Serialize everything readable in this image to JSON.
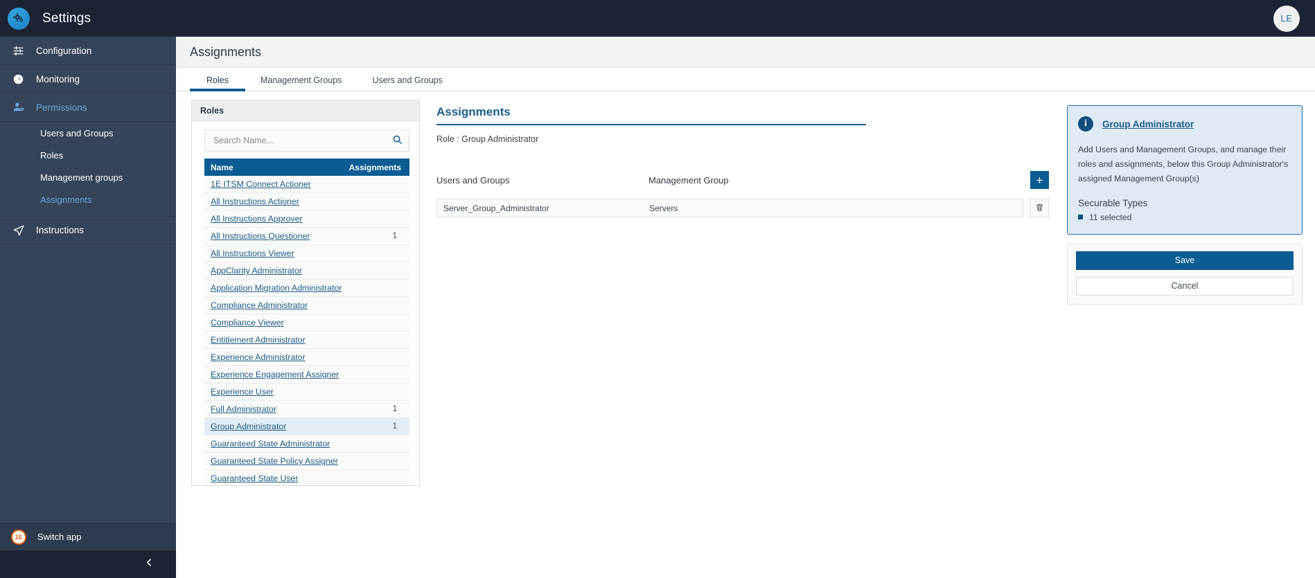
{
  "topbar": {
    "app_title": "Settings",
    "logo_icon": "gears-icon",
    "avatar_initials": "LE"
  },
  "sidebar": {
    "items": [
      {
        "label": "Configuration",
        "icon": "sliders-icon",
        "active": false
      },
      {
        "label": "Monitoring",
        "icon": "gauge-icon",
        "active": false
      },
      {
        "label": "Permissions",
        "icon": "user-gear-icon",
        "active": true
      }
    ],
    "subitems": [
      {
        "label": "Users and Groups",
        "active": false
      },
      {
        "label": "Roles",
        "active": false
      },
      {
        "label": "Management groups",
        "active": false
      },
      {
        "label": "Assignments",
        "active": true
      }
    ],
    "instructions": {
      "label": "Instructions",
      "icon": "paper-plane-icon"
    },
    "switch_app": {
      "label": "Switch app",
      "logo_text": "1E"
    },
    "collapse_icon": "chevron-left-icon"
  },
  "page": {
    "title": "Assignments",
    "tabs": [
      {
        "label": "Roles",
        "active": true
      },
      {
        "label": "Management Groups",
        "active": false
      },
      {
        "label": "Users and Groups",
        "active": false
      }
    ]
  },
  "roles_panel": {
    "header": "Roles",
    "search": {
      "placeholder": "Search Name...",
      "value": "",
      "icon": "search-icon"
    },
    "columns": {
      "name": "Name",
      "assignments": "Assignments"
    },
    "rows": [
      {
        "name": "1E ITSM Connect Actioner",
        "assignments": "",
        "selected": false
      },
      {
        "name": "All Instructions Actioner",
        "assignments": "",
        "selected": false
      },
      {
        "name": "All Instructions Approver",
        "assignments": "",
        "selected": false
      },
      {
        "name": "All Instructions Questioner",
        "assignments": "1",
        "selected": false
      },
      {
        "name": "All Instructions Viewer",
        "assignments": "",
        "selected": false
      },
      {
        "name": "AppClarity Administrator",
        "assignments": "",
        "selected": false
      },
      {
        "name": "Application Migration Administrator",
        "assignments": "",
        "selected": false
      },
      {
        "name": "Compliance Administrator",
        "assignments": "",
        "selected": false
      },
      {
        "name": "Compliance Viewer",
        "assignments": "",
        "selected": false
      },
      {
        "name": "Entitlement Administrator",
        "assignments": "",
        "selected": false
      },
      {
        "name": "Experience Administrator",
        "assignments": "",
        "selected": false
      },
      {
        "name": "Experience Engagement Assigner",
        "assignments": "",
        "selected": false
      },
      {
        "name": "Experience User",
        "assignments": "",
        "selected": false
      },
      {
        "name": "Full Administrator",
        "assignments": "1",
        "selected": false
      },
      {
        "name": "Group Administrator",
        "assignments": "1",
        "selected": true
      },
      {
        "name": "Guaranteed State Administrator",
        "assignments": "",
        "selected": false
      },
      {
        "name": "Guaranteed State Policy Assigner",
        "assignments": "",
        "selected": false
      },
      {
        "name": "Guaranteed State User",
        "assignments": "",
        "selected": false
      }
    ]
  },
  "assignments": {
    "title": "Assignments",
    "role_line": "Role : Group Administrator",
    "col_users": "Users and Groups",
    "col_mg": "Management Group",
    "add_label": "+",
    "add_icon": "plus-icon",
    "delete_icon": "trash-icon",
    "rows": [
      {
        "user": "Server_Group_Administrator",
        "management_group": "Servers"
      }
    ]
  },
  "info_card": {
    "icon": "info-icon",
    "title": "Group Administrator",
    "description": "Add Users and Management Groups, and manage their roles and assignments, below this Group Administrator's assigned Management Group(s)",
    "securable_title": "Securable Types",
    "securable_value": "11 selected"
  },
  "actions": {
    "save_label": "Save",
    "cancel_label": "Cancel"
  },
  "colors": {
    "accent": "#0b5c92",
    "sidebar": "#364459",
    "topbar": "#1c2333",
    "link": "#1f5b85",
    "info_bg": "#dfeaf4",
    "info_border": "#1b6ca8"
  }
}
